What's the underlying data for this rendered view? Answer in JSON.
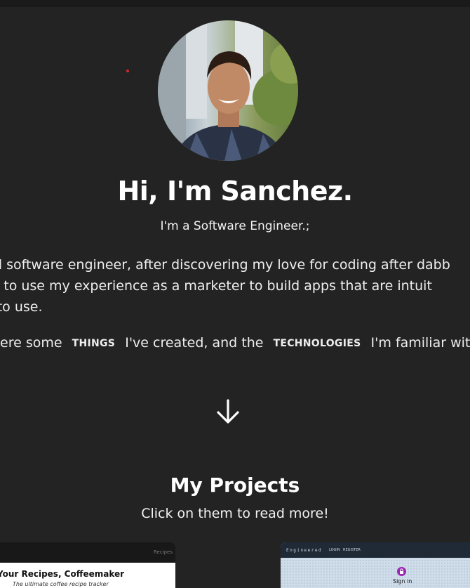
{
  "hero": {
    "headline": "Hi, I'm Sanchez.",
    "role": "I'm a Software Engineer.;",
    "bio": {
      "line1": "d software engineer, after discovering my love for coding after dabb",
      "line2": "ted to use my experience as a marketer to build apps that are intuit",
      "line3": "e to use."
    },
    "things_line": {
      "prefix": "ere some",
      "tag_things": "THINGS",
      "middle": "I've created, and the",
      "tag_technologies": "TECHNOLOGIES",
      "suffix": "I'm familiar with."
    },
    "scroll_icon": "arrow-down-icon"
  },
  "projects": {
    "title": "My Projects",
    "subtitle": "Click on them to read more!",
    "cards": [
      {
        "corner_label": "Recipes",
        "title": "Your Recipes, Coffeemaker",
        "subtitle": "The ultimate coffee recipe tracker"
      },
      {
        "brand": "Engineered",
        "nav_login": "LOGIN",
        "nav_register": "REGISTER",
        "signin": "Sign in",
        "icon": "lock-icon"
      }
    ]
  },
  "colors": {
    "background": "#232323",
    "text": "#ffffff",
    "accent_dot": "#d62a2a",
    "signin_icon": "#9c27b0"
  }
}
